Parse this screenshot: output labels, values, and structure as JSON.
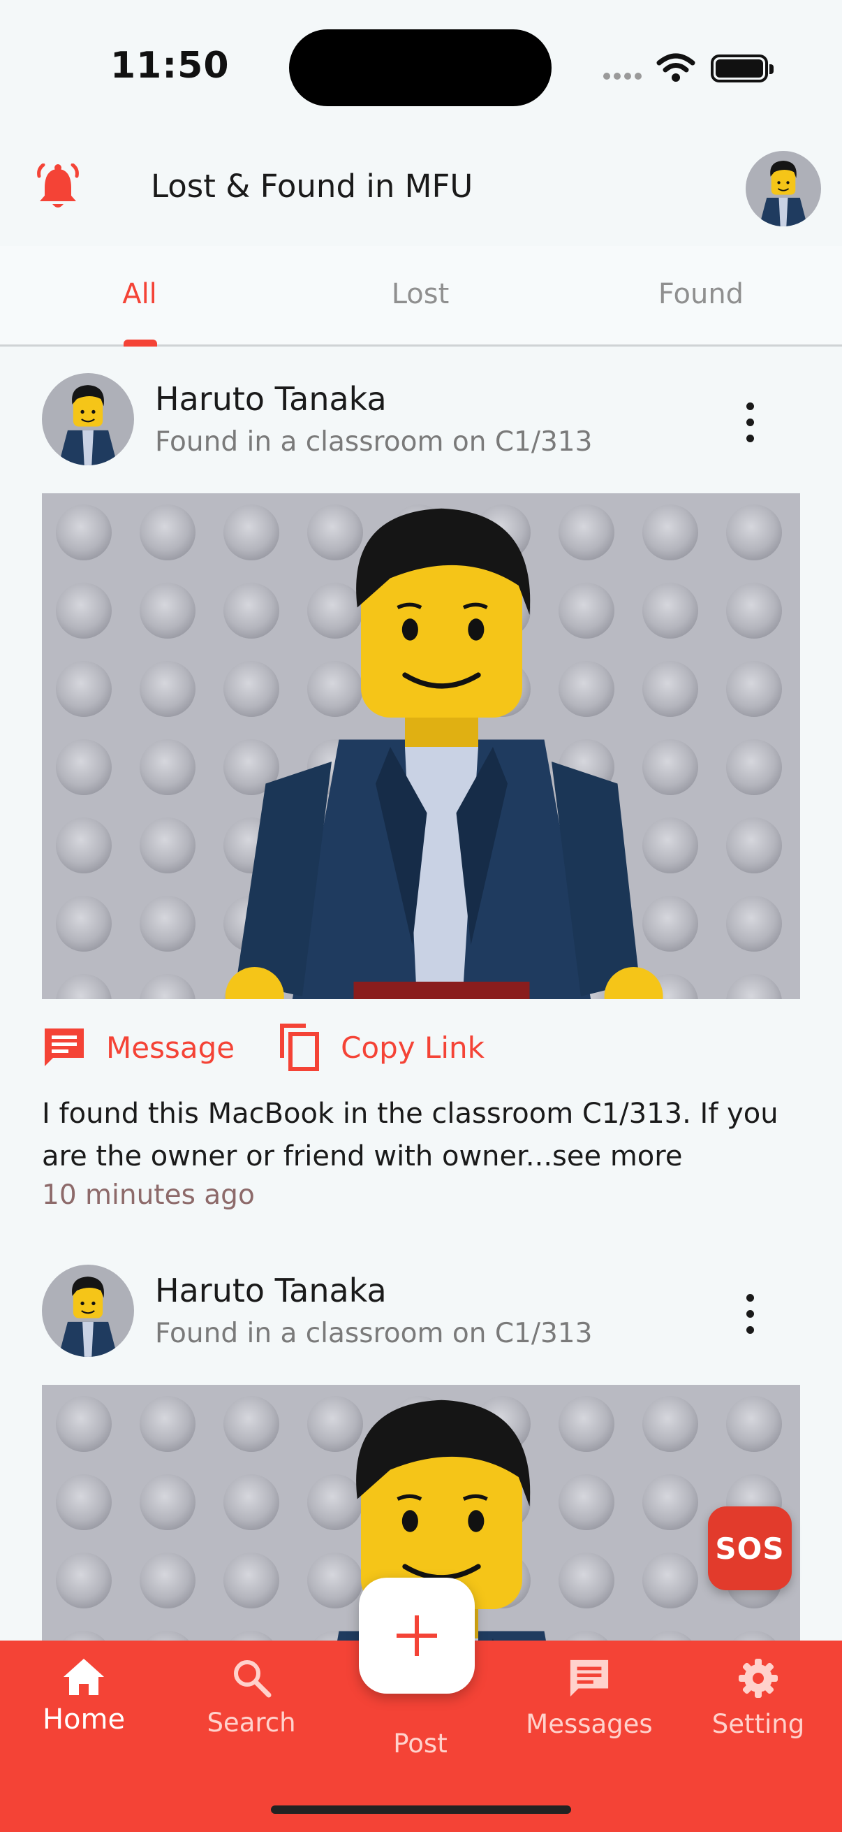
{
  "status_bar": {
    "time": "11:50"
  },
  "header": {
    "title": "Lost & Found in MFU"
  },
  "tabs": [
    {
      "label": "All",
      "active": true
    },
    {
      "label": "Lost",
      "active": false
    },
    {
      "label": "Found",
      "active": false
    }
  ],
  "posts": [
    {
      "author": "Haruto Tanaka",
      "subtitle": "Found in a classroom on C1/313",
      "message_label": "Message",
      "copy_link_label": "Copy Link",
      "description": "I found this MacBook in the classroom C1/313. If you are the owner or friend with owner...see more",
      "time_ago": "10 minutes ago"
    },
    {
      "author": "Haruto Tanaka",
      "subtitle": "Found in a classroom on C1/313"
    }
  ],
  "sos_label": "SOS",
  "bottom_nav": [
    {
      "label": "Home",
      "icon": "home-icon",
      "active": true
    },
    {
      "label": "Search",
      "icon": "search-icon",
      "active": false
    },
    {
      "label": "Post",
      "icon": "plus-icon",
      "active": false
    },
    {
      "label": "Messages",
      "icon": "message-icon",
      "active": false
    },
    {
      "label": "Setting",
      "icon": "gear-icon",
      "active": false
    }
  ],
  "colors": {
    "accent": "#f44336",
    "background": "#f4f8f9"
  }
}
